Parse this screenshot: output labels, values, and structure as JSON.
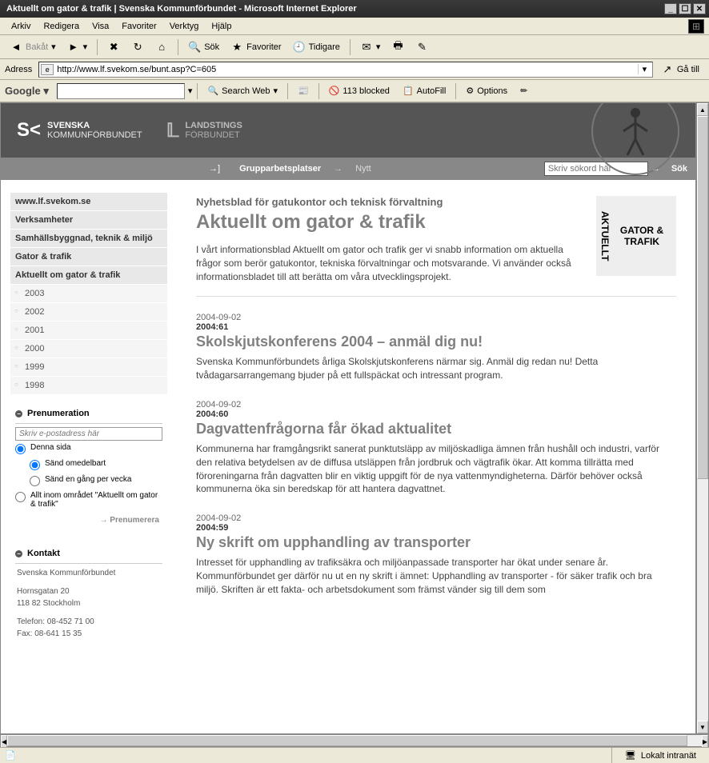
{
  "window": {
    "title": "Aktuellt om gator & trafik | Svenska Kommunförbundet - Microsoft Internet Explorer"
  },
  "menubar": {
    "items": [
      "Arkiv",
      "Redigera",
      "Visa",
      "Favoriter",
      "Verktyg",
      "Hjälp"
    ]
  },
  "toolbar": {
    "back": "Bakåt",
    "search": "Sök",
    "favorites": "Favoriter",
    "history": "Tidigare"
  },
  "addressbar": {
    "label": "Adress",
    "url": "http://www.lf.svekom.se/bunt.asp?C=605",
    "go": "Gå till"
  },
  "googlebar": {
    "logo": "Google",
    "search": "Search Web",
    "blocked": "113 blocked",
    "autofill": "AutoFill",
    "options": "Options"
  },
  "header": {
    "brand1_top": "SVENSKA",
    "brand1_bottom": "KOMMUNFÖRBUNDET",
    "brand2_top": "LANDSTINGS",
    "brand2_bottom": "FÖRBUNDET"
  },
  "navbar": {
    "item1": "Grupparbetsplatser",
    "item2": "Nytt",
    "search_placeholder": "Skriv sökord här",
    "sok": "Sök"
  },
  "sidebar": {
    "links": [
      {
        "label": "www.lf.svekom.se"
      },
      {
        "label": "Verksamheter"
      },
      {
        "label": "Samhällsbyggnad, teknik & miljö"
      },
      {
        "label": "Gator & trafik"
      },
      {
        "label": "Aktuellt om gator & trafik"
      }
    ],
    "years": [
      "2003",
      "2002",
      "2001",
      "2000",
      "1999",
      "1998"
    ],
    "subscription": {
      "title": "Prenumeration",
      "placeholder": "Skriv e-postadress här",
      "opt_this": "Denna sida",
      "opt_immed": "Sänd omedelbart",
      "opt_weekly": "Sänd en gång per vecka",
      "opt_all": "Allt inom området \"Aktuellt om gator & trafik\"",
      "button": "Prenumerera"
    },
    "contact": {
      "title": "Kontakt",
      "org": "Svenska Kommunförbundet",
      "addr1": "Hornsgatan 20",
      "addr2": "118 82 Stockholm",
      "tel": "Telefon: 08-452 71 00",
      "fax": "Fax: 08-641 15 35"
    }
  },
  "main": {
    "pretitle": "Nyhetsblad för gatukontor och teknisk förvaltning",
    "title": "Aktuellt om gator & trafik",
    "intro": "I vårt informationsblad Aktuellt om gator och trafik ger vi snabb information om aktuella frågor som berör gatukontor, tekniska förvaltningar och motsvarande. Vi använder också informationsbladet till att berätta om våra utvecklingsprojekt.",
    "sideimg_v1": "AKTUELLT",
    "sideimg_t1": "GATOR",
    "sideimg_t2": "TRAFIK",
    "articles": [
      {
        "date": "2004-09-02",
        "num": "2004:61",
        "title": "Skolskjutskonferens 2004 – anmäl dig nu!",
        "body": "Svenska Kommunförbundets årliga Skolskjutskonferens närmar sig. Anmäl dig redan nu! Detta tvådagarsarrangemang bjuder på ett fullspäckat och intressant program."
      },
      {
        "date": "2004-09-02",
        "num": "2004:60",
        "title": "Dagvattenfrågorna får ökad aktualitet",
        "body": "Kommunerna har framgångsrikt sanerat punktutsläpp av miljöskadliga ämnen från hushåll och industri, varför den relativa betydelsen av de diffusa utsläppen från jordbruk och vägtrafik ökar. Att komma tillrätta med föroreningarna från dagvatten blir en viktig uppgift för de nya vattenmyndigheterna. Därför behöver också kommunerna öka sin beredskap för att hantera dagvattnet."
      },
      {
        "date": "2004-09-02",
        "num": "2004:59",
        "title": "Ny skrift om upphandling av transporter",
        "body": "Intresset för upphandling av trafiksäkra och miljöanpassade transporter har ökat under senare år. Kommunförbundet ger därför nu ut en ny skrift i ämnet: Upphandling av transporter - för säker trafik och bra miljö. Skriften är ett fakta- och arbetsdokument som främst vänder sig till dem som"
      }
    ]
  },
  "statusbar": {
    "zone": "Lokalt intranät"
  }
}
